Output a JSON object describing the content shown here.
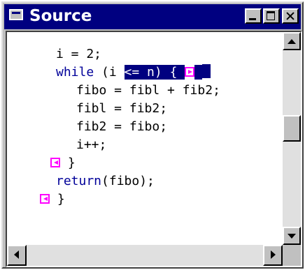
{
  "window": {
    "title": "Source"
  },
  "code": {
    "line1": "i = 2;",
    "line2": {
      "keyword": "while",
      "before_selection": " (i ",
      "selection": "<= n) {",
      "after_marker": " "
    },
    "line3": "fibo = fibl + fib2;",
    "line4": "fibl = fib2;",
    "line5": "fib2 = fibo;",
    "line6": "i++;",
    "line7": "}",
    "line8": {
      "keyword": "return",
      "rest": "(fibo);"
    },
    "line9": "}"
  },
  "colors": {
    "title_bar": "#000080",
    "keyword": "#000099",
    "selection": "#000080",
    "breakpoint_marker": "#ff00ff"
  },
  "icons": {
    "window": "window-icon",
    "minimize": "minimize-icon",
    "maximize": "maximize-icon",
    "close": "close-icon",
    "marker_right": "right-pointer-icon",
    "marker_left": "left-pointer-icon"
  }
}
